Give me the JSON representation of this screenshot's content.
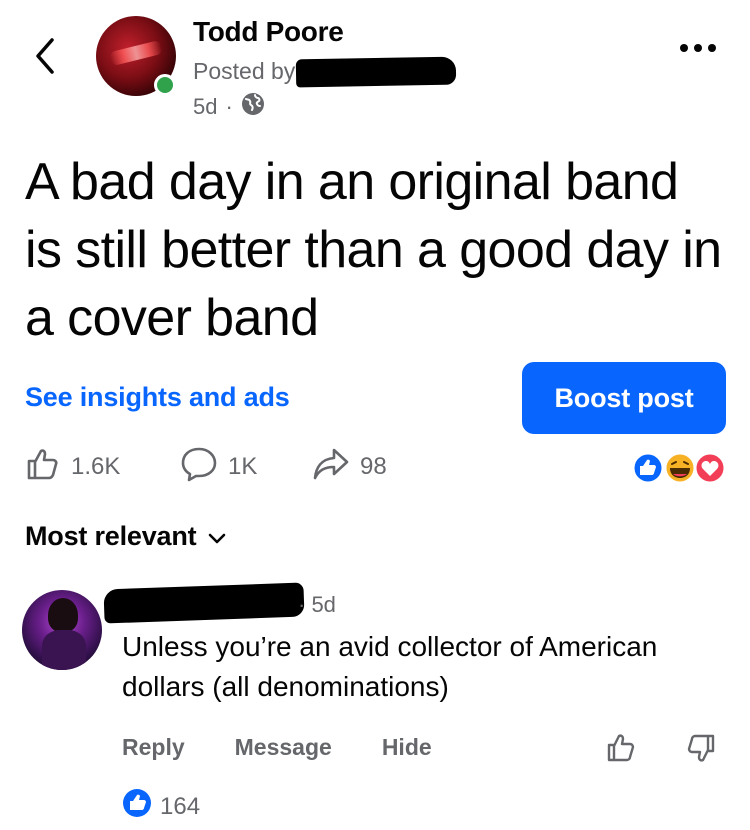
{
  "post": {
    "author": "Todd Poore",
    "posted_by_prefix": "Posted by",
    "age": "5d",
    "separator": "·",
    "text": "A bad day in an original band is still better than a good day in a cover band"
  },
  "actions": {
    "insights_label": "See insights and ads",
    "boost_label": "Boost post"
  },
  "stats": {
    "likes": "1.6K",
    "comments": "1K",
    "shares": "98"
  },
  "sort": {
    "label": "Most relevant"
  },
  "comment": {
    "age": "· 5d",
    "text": "Unless you’re an avid collector of American dollars (all denominations)",
    "reply_label": "Reply",
    "message_label": "Message",
    "hide_label": "Hide",
    "likes": "164"
  },
  "colors": {
    "accent": "#0866ff",
    "secondary_text": "#65676b",
    "online": "#31a24c",
    "love": "#f33e58",
    "haha": "#f7b125"
  },
  "icons": [
    "back-icon",
    "more-icon",
    "globe-icon",
    "like-icon",
    "comment-icon",
    "share-icon",
    "like-reaction-icon",
    "haha-reaction-icon",
    "love-reaction-icon",
    "chevron-down-icon",
    "thumbs-up-icon",
    "thumbs-down-icon"
  ]
}
